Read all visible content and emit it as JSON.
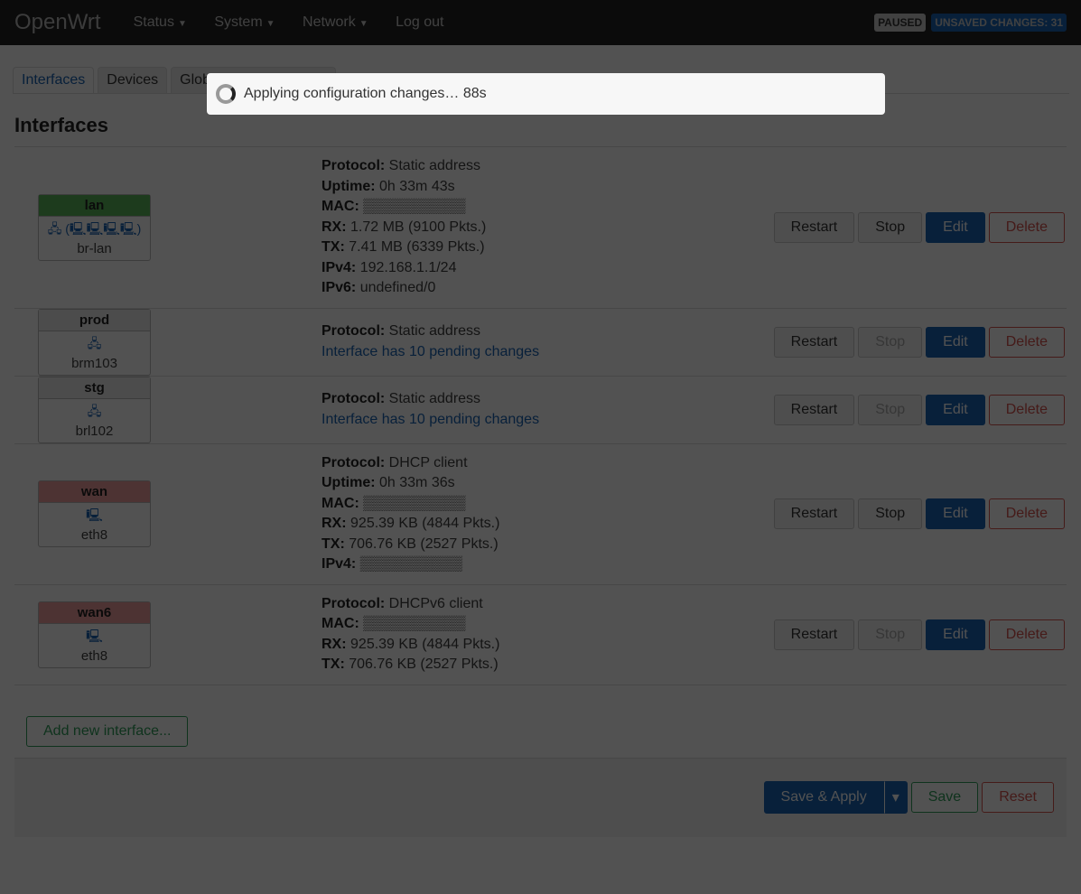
{
  "header": {
    "brand": "OpenWrt",
    "nav": [
      "Status",
      "System",
      "Network"
    ],
    "logout": "Log out",
    "paused": "PAUSED",
    "unsaved": "UNSAVED CHANGES: 31"
  },
  "tabs": [
    "Interfaces",
    "Devices",
    "Global network options"
  ],
  "title": "Interfaces",
  "interfaces": [
    {
      "name": "lan",
      "color": "#5cb85c",
      "icons": "🖧 (🖳🖳🖳🖳)",
      "device": "br-lan",
      "lines": [
        [
          "Protocol:",
          "Static address"
        ],
        [
          "Uptime:",
          "0h 33m 43s"
        ],
        [
          "MAC:",
          "▒▒▒▒▒▒▒▒▒▒"
        ],
        [
          "RX:",
          "1.72 MB (9100 Pkts.)"
        ],
        [
          "TX:",
          "7.41 MB (6339 Pkts.)"
        ],
        [
          "IPv4:",
          "192.168.1.1/24"
        ],
        [
          "IPv6:",
          "undefined/0"
        ]
      ],
      "pending": "",
      "stop_disabled": false
    },
    {
      "name": "prod",
      "color": "#eee",
      "icons": "🖧",
      "device": "brm103",
      "lines": [
        [
          "Protocol:",
          "Static address"
        ]
      ],
      "pending": "Interface has 10 pending changes",
      "stop_disabled": true
    },
    {
      "name": "stg",
      "color": "#eee",
      "icons": "🖧",
      "device": "brl102",
      "lines": [
        [
          "Protocol:",
          "Static address"
        ]
      ],
      "pending": "Interface has 10 pending changes",
      "stop_disabled": true
    },
    {
      "name": "wan",
      "color": "#f2a0a0",
      "icons": "🖳",
      "device": "eth8",
      "lines": [
        [
          "Protocol:",
          "DHCP client"
        ],
        [
          "Uptime:",
          "0h 33m 36s"
        ],
        [
          "MAC:",
          "▒▒▒▒▒▒▒▒▒▒"
        ],
        [
          "RX:",
          "925.39 KB (4844 Pkts.)"
        ],
        [
          "TX:",
          "706.76 KB (2527 Pkts.)"
        ],
        [
          "IPv4:",
          "▒▒▒▒▒▒▒▒▒▒"
        ]
      ],
      "pending": "",
      "stop_disabled": false
    },
    {
      "name": "wan6",
      "color": "#f2a0a0",
      "icons": "🖳",
      "device": "eth8",
      "lines": [
        [
          "Protocol:",
          "DHCPv6 client"
        ],
        [
          "MAC:",
          "▒▒▒▒▒▒▒▒▒▒"
        ],
        [
          "RX:",
          "925.39 KB (4844 Pkts.)"
        ],
        [
          "TX:",
          "706.76 KB (2527 Pkts.)"
        ]
      ],
      "pending": "",
      "stop_disabled": true
    }
  ],
  "actions": {
    "restart": "Restart",
    "stop": "Stop",
    "edit": "Edit",
    "delete": "Delete"
  },
  "add_label": "Add new interface...",
  "footer": {
    "save_apply": "Save & Apply",
    "dropdown": "▾",
    "save": "Save",
    "reset": "Reset"
  },
  "modal": {
    "text": "Applying configuration changes… 88s"
  }
}
